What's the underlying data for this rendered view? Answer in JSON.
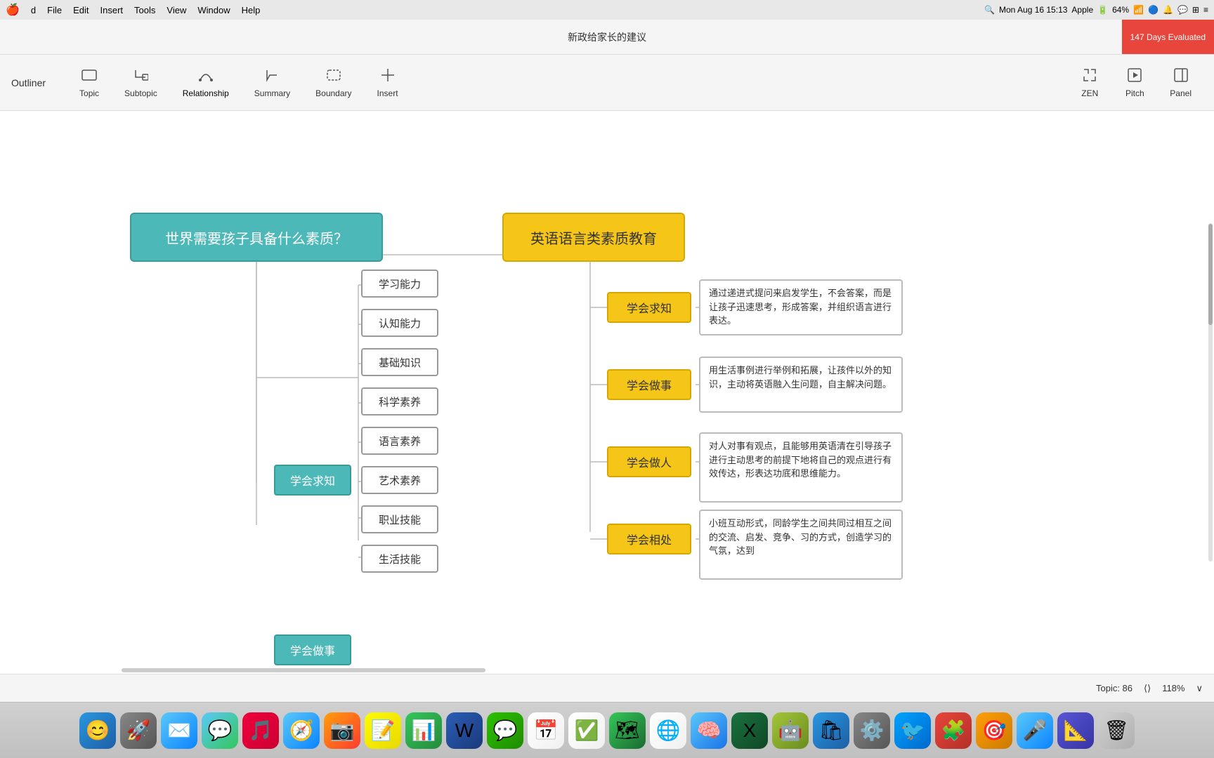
{
  "menubar": {
    "apple": "🍎",
    "items": [
      "d",
      "File",
      "Edit",
      "Insert",
      "Tools",
      "View",
      "Window",
      "Help"
    ],
    "time": "Mon Aug 16  15:13",
    "apple_label": "Apple",
    "battery": "64%",
    "wifi": "WiFi",
    "bluetooth": "BT"
  },
  "titlebar": {
    "title": "新政给家长的建议",
    "badge": "147 Days Evaluated"
  },
  "toolbar": {
    "outliner": "Outliner",
    "items": [
      {
        "id": "topic",
        "label": "Topic",
        "icon": "⬡"
      },
      {
        "id": "subtopic",
        "label": "Subtopic",
        "icon": "↩"
      },
      {
        "id": "relationship",
        "label": "Relationship",
        "icon": "⌒",
        "active": true
      },
      {
        "id": "summary",
        "label": "Summary",
        "icon": "⬦"
      },
      {
        "id": "boundary",
        "label": "Boundary",
        "icon": "⬜"
      },
      {
        "id": "insert",
        "label": "Insert",
        "icon": "+"
      },
      {
        "id": "zen",
        "label": "ZEN",
        "icon": "⤢"
      },
      {
        "id": "pitch",
        "label": "Pitch",
        "icon": "▶"
      },
      {
        "id": "panel",
        "label": "Panel",
        "icon": "▦"
      }
    ]
  },
  "mindmap": {
    "root": "世界需要孩子具备什么素质？",
    "right_main": "英语语言类素质教育",
    "left_branches": [
      {
        "label": "学会求知",
        "sub": [
          "学习能力",
          "认知能力",
          "基础知识",
          "科学素养",
          "语言素养",
          "艺术素养",
          "职业技能",
          "生活技能"
        ]
      },
      {
        "label": "学会做事"
      }
    ],
    "right_branches": [
      {
        "label": "学会求知",
        "desc": "通过递进式提问来启发学生，不会答案，而是让孩子迅速思考，形成答案，并组织语言进行表达。"
      },
      {
        "label": "学会做事",
        "desc": "用生活事例进行举例和拓展，让孩件以外的知识，主动将英语融入生问题，自主解决问题。"
      },
      {
        "label": "学会做人",
        "desc": "对人对事有观点，且能够用英语清在引导孩子进行主动思考的前提下地将自己的观点进行有效传达，形表达功底和思维能力。"
      },
      {
        "label": "学会相处",
        "desc": "小班互动形式，同龄学生之间共同过相互之间的交流、启发、竞争、习的方式，创造学习的气氛，达到"
      }
    ]
  },
  "statusbar": {
    "topic_count": "Topic: 86",
    "zoom": "118%"
  },
  "dock": {
    "icons": [
      "🔍",
      "📁",
      "🌐",
      "💬",
      "📧",
      "🗓",
      "💾",
      "📝",
      "📊",
      "🎵",
      "🎬",
      "📷",
      "🔧",
      "🌍",
      "🎮",
      "📱",
      "⚙️",
      "🖥"
    ]
  }
}
